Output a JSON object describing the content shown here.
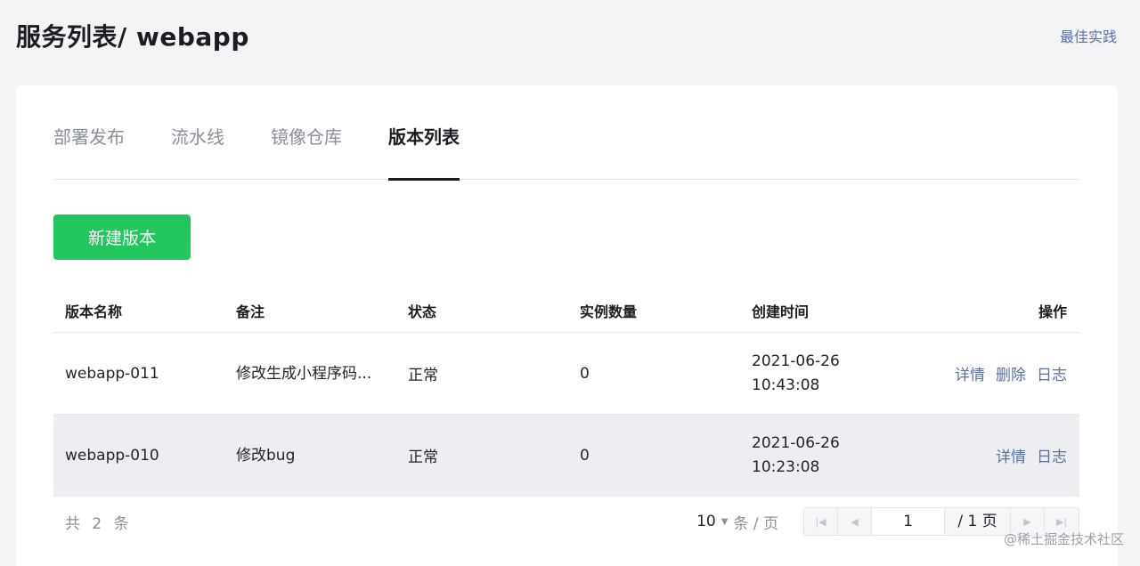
{
  "header": {
    "title": "服务列表/ webapp",
    "best_practice": "最佳实践"
  },
  "tabs": [
    {
      "label": "部署发布"
    },
    {
      "label": "流水线"
    },
    {
      "label": "镜像仓库"
    },
    {
      "label": "版本列表",
      "active": true
    }
  ],
  "new_button": "新建版本",
  "table": {
    "columns": [
      "版本名称",
      "备注",
      "状态",
      "实例数量",
      "创建时间",
      "操作"
    ],
    "rows": [
      {
        "name": "webapp-011",
        "remark": "修改生成小程序码...",
        "status": "正常",
        "instances": "0",
        "date": "2021-06-26",
        "time": "10:43:08",
        "actions": [
          "详情",
          "删除",
          "日志"
        ]
      },
      {
        "name": "webapp-010",
        "remark": "修改bug",
        "status": "正常",
        "instances": "0",
        "date": "2021-06-26",
        "time": "10:23:08",
        "actions": [
          "详情",
          "日志"
        ]
      }
    ]
  },
  "pagination": {
    "total_text": "共 2 条",
    "page_size": "10",
    "page_size_unit": "条 / 页",
    "current_page": "1",
    "total_pages": "/ 1 页"
  },
  "watermark": "@稀土掘金技术社区",
  "colors": {
    "primary": "#22c55e",
    "link": "#5a6fa8"
  }
}
